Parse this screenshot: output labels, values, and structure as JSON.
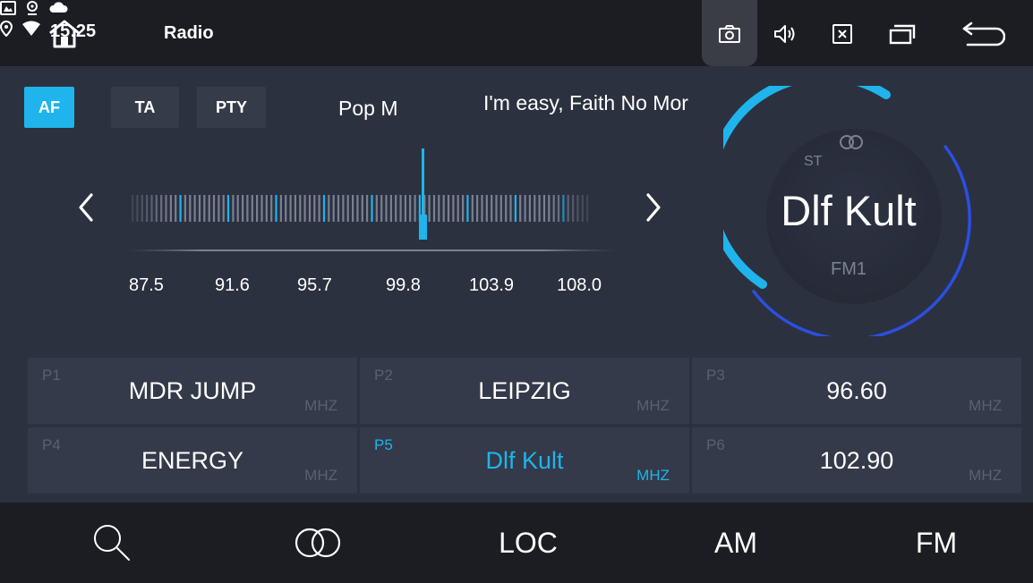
{
  "status_bar": {
    "app_title": "Radio",
    "time": "15:25",
    "icons": [
      "home-icon",
      "gallery-icon",
      "location-icon",
      "cloud-icon",
      "location-icon",
      "wifi-icon",
      "screenshot-icon",
      "volume-icon",
      "close-app-icon",
      "recent-apps-icon",
      "back-icon"
    ]
  },
  "controls": {
    "af_label": "AF",
    "ta_label": "TA",
    "pty_label": "PTY",
    "pty_value": "Pop M",
    "rds_text": "I'm easy, Faith No Mor"
  },
  "tuner": {
    "frequency_labels": [
      "87.5",
      "91.6",
      "95.7",
      "99.8",
      "103.9",
      "108.0"
    ],
    "accent_color": "#1fb4ec"
  },
  "station": {
    "stereo_label": "ST",
    "name": "Dlf Kult",
    "band": "FM1"
  },
  "presets": [
    {
      "number": "P1",
      "name": "MDR JUMP",
      "unit": "MHZ",
      "active": false
    },
    {
      "number": "P2",
      "name": "LEIPZIG",
      "unit": "MHZ",
      "active": false
    },
    {
      "number": "P3",
      "name": "96.60",
      "unit": "MHZ",
      "active": false
    },
    {
      "number": "P4",
      "name": "ENERGY",
      "unit": "MHZ",
      "active": false
    },
    {
      "number": "P5",
      "name": "Dlf Kult",
      "unit": "MHZ",
      "active": true
    },
    {
      "number": "P6",
      "name": "102.90",
      "unit": "MHZ",
      "active": false
    }
  ],
  "bottom_bar": {
    "loc_label": "LOC",
    "am_label": "AM",
    "fm_label": "FM"
  }
}
